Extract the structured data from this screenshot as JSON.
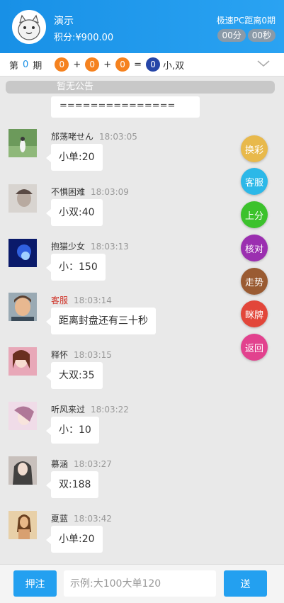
{
  "header": {
    "user_name": "演示",
    "points": "积分:¥900.00",
    "period_info": "极速PC距离0期",
    "timer_minutes": "00分",
    "timer_seconds": "00秒"
  },
  "result": {
    "label_prefix": "第",
    "period": "0",
    "label_suffix": "期",
    "balls": [
      "0",
      "0",
      "0"
    ],
    "plus": "+",
    "equals": "=",
    "sum": "0",
    "outcome": "小,双",
    "colors": {
      "ball": "#f5821f",
      "sum": "#2646a8"
    }
  },
  "notice": "暂无公告",
  "separator_text": "===============",
  "messages": [
    {
      "nick": "邡荡咾せん",
      "time": "18:03:05",
      "text": "小单:20",
      "avatar": "forest-girl-avatar"
    },
    {
      "nick": "不惧困难",
      "time": "18:03:09",
      "text": "小双:40",
      "avatar": "portrait-avatar"
    },
    {
      "nick": "抱猫少女",
      "time": "18:03:13",
      "text": "小：150",
      "avatar": "anime-blue-avatar"
    },
    {
      "nick": "客服",
      "time": "18:03:14",
      "text": "距离封盘还有三十秒",
      "avatar": "service-avatar"
    },
    {
      "nick": "释怀",
      "time": "18:03:15",
      "text": "大双:35",
      "avatar": "girl-pink-avatar"
    },
    {
      "nick": "听风来过",
      "time": "18:03:22",
      "text": "小：10",
      "avatar": "girl-light-avatar"
    },
    {
      "nick": "慕涵",
      "time": "18:03:27",
      "text": "双:188",
      "avatar": "girl-dark-avatar"
    },
    {
      "nick": "夏蓝",
      "time": "18:03:42",
      "text": "小单:20",
      "avatar": "girl-beach-avatar"
    }
  ],
  "side_buttons": [
    {
      "label": "换彩",
      "color": "#e8b94c"
    },
    {
      "label": "客服",
      "color": "#2cb8e8"
    },
    {
      "label": "上分",
      "color": "#3cc22c"
    },
    {
      "label": "核对",
      "color": "#9b2fb0"
    },
    {
      "label": "走势",
      "color": "#9a5b32"
    },
    {
      "label": "眯牌",
      "color": "#e2463a"
    },
    {
      "label": "返回",
      "color": "#e2428e"
    }
  ],
  "footer": {
    "bet_label": "押注",
    "input_placeholder": "示例:大100大单120",
    "input_value": "",
    "send_label": "送"
  }
}
